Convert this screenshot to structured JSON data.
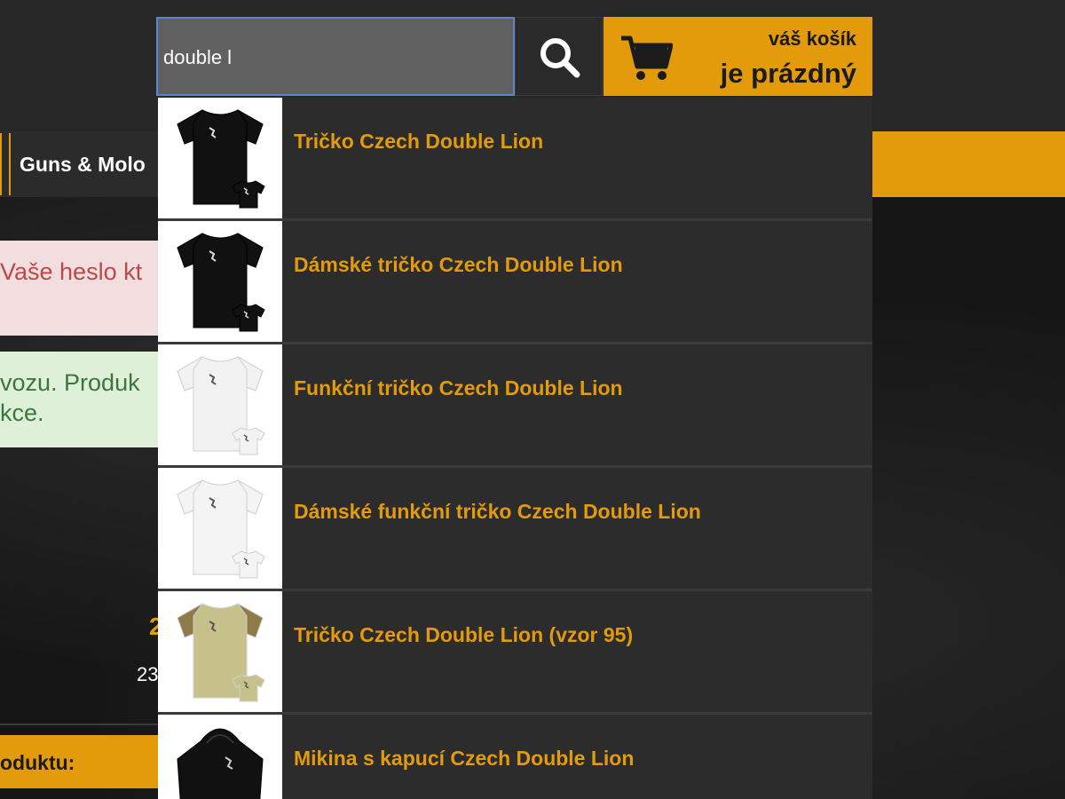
{
  "search": {
    "value": "double l"
  },
  "cart": {
    "label_small": "váš košík",
    "label_big": "je prázdný"
  },
  "nav": {
    "item": "Guns & Molo"
  },
  "alerts": {
    "danger_text": "Vaše heslo kt",
    "success_line1": "vozu. Produk",
    "success_line2": "kce."
  },
  "fragments": {
    "price": "2",
    "small": "23",
    "product_bar": "oduktu:"
  },
  "suggestions": [
    {
      "label": "Tričko Czech Double Lion",
      "shirt_color": "#111111",
      "sleeve_color": "#111111"
    },
    {
      "label": "Dámské tričko Czech Double Lion",
      "shirt_color": "#111111",
      "sleeve_color": "#111111"
    },
    {
      "label": "Funkční tričko Czech Double Lion",
      "shirt_color": "#f2f2f2",
      "sleeve_color": "#f2f2f2"
    },
    {
      "label": "Dámské funkční tričko Czech Double Lion",
      "shirt_color": "#f4f4f4",
      "sleeve_color": "#f4f4f4"
    },
    {
      "label": "Tričko Czech Double Lion (vzor 95)",
      "shirt_color": "#c6c08a",
      "sleeve_color": "#8f7a4a"
    },
    {
      "label": "Mikina s kapucí Czech Double Lion",
      "shirt_color": "#111111",
      "sleeve_color": "#111111"
    }
  ],
  "colors": {
    "accent": "#e39a0b",
    "dark": "#272727"
  }
}
